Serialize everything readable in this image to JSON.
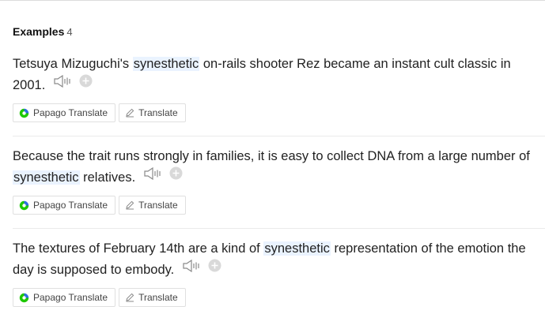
{
  "section": {
    "title": "Examples",
    "count": "4"
  },
  "examples": [
    {
      "before": "Tetsuya Mizuguchi's ",
      "highlight": "synesthetic",
      "after": " on-rails shooter Rez became an instant cult classic in 2001.",
      "papago_label": "Papago Translate",
      "translate_label": "Translate"
    },
    {
      "before": "Because the trait runs strongly in families, it is easy to collect DNA from a large number of ",
      "highlight": "synesthetic",
      "after": " relatives.",
      "papago_label": "Papago Translate",
      "translate_label": "Translate"
    },
    {
      "before": "The textures of February 14th are a kind of ",
      "highlight": "synesthetic",
      "after": " representation of the emotion the day is supposed to embody.",
      "papago_label": "Papago Translate",
      "translate_label": "Translate"
    }
  ],
  "icons": {
    "speaker": "speaker-icon",
    "add": "plus-circle-icon",
    "papago": "papago-logo-icon",
    "translate": "pencil-icon"
  },
  "colors": {
    "highlight": "#eaf3ff",
    "papago_green": "#1ec800",
    "papago_blue": "#2f6fe0"
  }
}
